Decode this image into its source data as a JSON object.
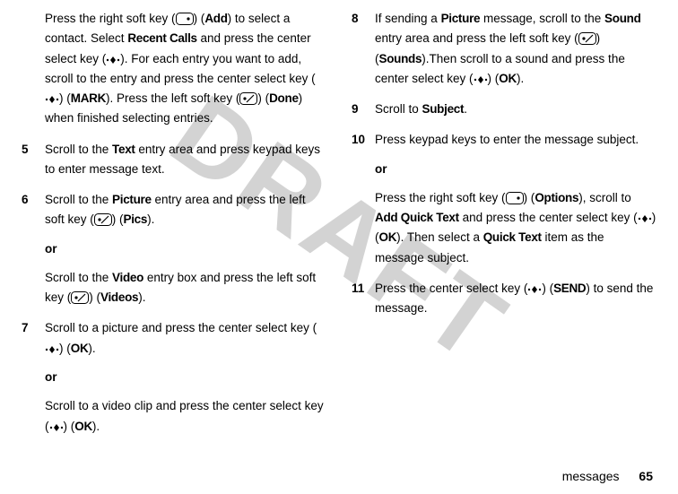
{
  "watermark": "DRAFT",
  "footer": {
    "label": "messages",
    "page": "65"
  },
  "icons": {
    "right_soft": "right-soft-key-icon",
    "left_soft": "left-soft-key-icon",
    "center": "center-select-key-icon"
  },
  "labels": {
    "Add": "Add",
    "RecentCalls": "Recent Calls",
    "MARK": "MARK",
    "Done": "Done",
    "Text": "Text",
    "Picture": "Picture",
    "Pics": "Pics",
    "Video": "Video",
    "Videos": "Videos",
    "OK": "OK",
    "Sound": "Sound",
    "Sounds": "Sounds",
    "Subject": "Subject",
    "Options": "Options",
    "AddQuickText": "Add Quick Text",
    "QuickText": "Quick Text",
    "SEND": "SEND",
    "or": "or"
  },
  "steps": {
    "s4": {
      "pre": "Press the right soft key (",
      "mid1": ") (",
      "t1": ") to select a contact. Select ",
      "t2": " and press the center select key (",
      "t3": "). For each entry you want to add, scroll to the entry and press the center select key (",
      "t4": ") (",
      "t5": "). Press the left soft key (",
      "t6": ") (",
      "t7": ") when finished selecting entries."
    },
    "s5": {
      "num": "5",
      "t1": "Scroll to the ",
      "t2": " entry area and press keypad keys to enter message text."
    },
    "s6": {
      "num": "6",
      "t1": "Scroll to the ",
      "t2": " entry area and press the left soft key (",
      "t3": ") (",
      "t4": ").",
      "alt_t1": "Scroll to the ",
      "alt_t2": " entry box and press the left soft key (",
      "alt_t3": ") (",
      "alt_t4": ")."
    },
    "s7": {
      "num": "7",
      "t1": "Scroll to a picture and press the center select key (",
      "t2": ") (",
      "t3": ").",
      "alt_t1": "Scroll to a video clip and press the center select key (",
      "alt_t2": ") (",
      "alt_t3": ")."
    },
    "s8": {
      "num": "8",
      "t1": "If sending a ",
      "t2": " message, scroll to the ",
      "t3": " entry area and press the left soft key (",
      "t4": ") (",
      "t5": ").Then scroll to a sound and press the center select key (",
      "t6": ") (",
      "t7": ")."
    },
    "s9": {
      "num": "9",
      "t1": "Scroll to ",
      "t2": "."
    },
    "s10": {
      "num": "10",
      "t1": "Press keypad keys to enter the message subject.",
      "alt_t1": "Press the right soft key (",
      "alt_t2": ") (",
      "alt_t3": "), scroll to ",
      "alt_t4": " and press the center select key (",
      "alt_t5": ") (",
      "alt_t6": "). Then select a ",
      "alt_t7": " item as the message subject."
    },
    "s11": {
      "num": "11",
      "t1": "Press the center select key (",
      "t2": ") (",
      "t3": ") to send the message."
    }
  }
}
